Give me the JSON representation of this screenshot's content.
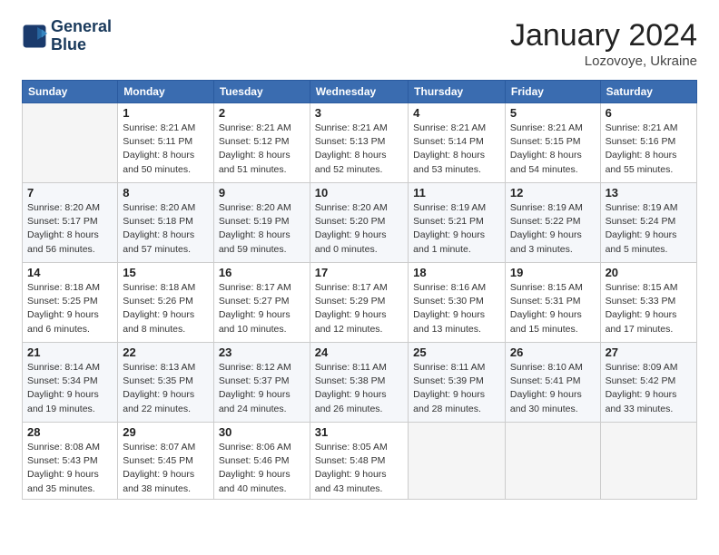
{
  "header": {
    "logo_line1": "General",
    "logo_line2": "Blue",
    "month": "January 2024",
    "location": "Lozovoye, Ukraine"
  },
  "weekdays": [
    "Sunday",
    "Monday",
    "Tuesday",
    "Wednesday",
    "Thursday",
    "Friday",
    "Saturday"
  ],
  "weeks": [
    [
      {
        "day": "",
        "info": ""
      },
      {
        "day": "1",
        "info": "Sunrise: 8:21 AM\nSunset: 5:11 PM\nDaylight: 8 hours\nand 50 minutes."
      },
      {
        "day": "2",
        "info": "Sunrise: 8:21 AM\nSunset: 5:12 PM\nDaylight: 8 hours\nand 51 minutes."
      },
      {
        "day": "3",
        "info": "Sunrise: 8:21 AM\nSunset: 5:13 PM\nDaylight: 8 hours\nand 52 minutes."
      },
      {
        "day": "4",
        "info": "Sunrise: 8:21 AM\nSunset: 5:14 PM\nDaylight: 8 hours\nand 53 minutes."
      },
      {
        "day": "5",
        "info": "Sunrise: 8:21 AM\nSunset: 5:15 PM\nDaylight: 8 hours\nand 54 minutes."
      },
      {
        "day": "6",
        "info": "Sunrise: 8:21 AM\nSunset: 5:16 PM\nDaylight: 8 hours\nand 55 minutes."
      }
    ],
    [
      {
        "day": "7",
        "info": "Sunrise: 8:20 AM\nSunset: 5:17 PM\nDaylight: 8 hours\nand 56 minutes."
      },
      {
        "day": "8",
        "info": "Sunrise: 8:20 AM\nSunset: 5:18 PM\nDaylight: 8 hours\nand 57 minutes."
      },
      {
        "day": "9",
        "info": "Sunrise: 8:20 AM\nSunset: 5:19 PM\nDaylight: 8 hours\nand 59 minutes."
      },
      {
        "day": "10",
        "info": "Sunrise: 8:20 AM\nSunset: 5:20 PM\nDaylight: 9 hours\nand 0 minutes."
      },
      {
        "day": "11",
        "info": "Sunrise: 8:19 AM\nSunset: 5:21 PM\nDaylight: 9 hours\nand 1 minute."
      },
      {
        "day": "12",
        "info": "Sunrise: 8:19 AM\nSunset: 5:22 PM\nDaylight: 9 hours\nand 3 minutes."
      },
      {
        "day": "13",
        "info": "Sunrise: 8:19 AM\nSunset: 5:24 PM\nDaylight: 9 hours\nand 5 minutes."
      }
    ],
    [
      {
        "day": "14",
        "info": "Sunrise: 8:18 AM\nSunset: 5:25 PM\nDaylight: 9 hours\nand 6 minutes."
      },
      {
        "day": "15",
        "info": "Sunrise: 8:18 AM\nSunset: 5:26 PM\nDaylight: 9 hours\nand 8 minutes."
      },
      {
        "day": "16",
        "info": "Sunrise: 8:17 AM\nSunset: 5:27 PM\nDaylight: 9 hours\nand 10 minutes."
      },
      {
        "day": "17",
        "info": "Sunrise: 8:17 AM\nSunset: 5:29 PM\nDaylight: 9 hours\nand 12 minutes."
      },
      {
        "day": "18",
        "info": "Sunrise: 8:16 AM\nSunset: 5:30 PM\nDaylight: 9 hours\nand 13 minutes."
      },
      {
        "day": "19",
        "info": "Sunrise: 8:15 AM\nSunset: 5:31 PM\nDaylight: 9 hours\nand 15 minutes."
      },
      {
        "day": "20",
        "info": "Sunrise: 8:15 AM\nSunset: 5:33 PM\nDaylight: 9 hours\nand 17 minutes."
      }
    ],
    [
      {
        "day": "21",
        "info": "Sunrise: 8:14 AM\nSunset: 5:34 PM\nDaylight: 9 hours\nand 19 minutes."
      },
      {
        "day": "22",
        "info": "Sunrise: 8:13 AM\nSunset: 5:35 PM\nDaylight: 9 hours\nand 22 minutes."
      },
      {
        "day": "23",
        "info": "Sunrise: 8:12 AM\nSunset: 5:37 PM\nDaylight: 9 hours\nand 24 minutes."
      },
      {
        "day": "24",
        "info": "Sunrise: 8:11 AM\nSunset: 5:38 PM\nDaylight: 9 hours\nand 26 minutes."
      },
      {
        "day": "25",
        "info": "Sunrise: 8:11 AM\nSunset: 5:39 PM\nDaylight: 9 hours\nand 28 minutes."
      },
      {
        "day": "26",
        "info": "Sunrise: 8:10 AM\nSunset: 5:41 PM\nDaylight: 9 hours\nand 30 minutes."
      },
      {
        "day": "27",
        "info": "Sunrise: 8:09 AM\nSunset: 5:42 PM\nDaylight: 9 hours\nand 33 minutes."
      }
    ],
    [
      {
        "day": "28",
        "info": "Sunrise: 8:08 AM\nSunset: 5:43 PM\nDaylight: 9 hours\nand 35 minutes."
      },
      {
        "day": "29",
        "info": "Sunrise: 8:07 AM\nSunset: 5:45 PM\nDaylight: 9 hours\nand 38 minutes."
      },
      {
        "day": "30",
        "info": "Sunrise: 8:06 AM\nSunset: 5:46 PM\nDaylight: 9 hours\nand 40 minutes."
      },
      {
        "day": "31",
        "info": "Sunrise: 8:05 AM\nSunset: 5:48 PM\nDaylight: 9 hours\nand 43 minutes."
      },
      {
        "day": "",
        "info": ""
      },
      {
        "day": "",
        "info": ""
      },
      {
        "day": "",
        "info": ""
      }
    ]
  ]
}
